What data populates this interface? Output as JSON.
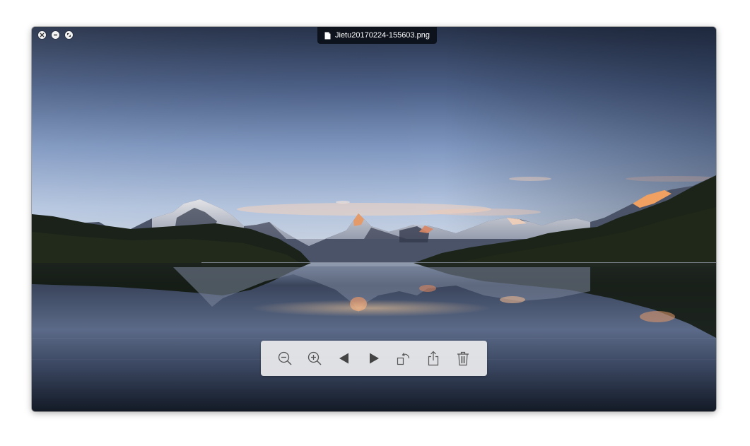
{
  "window": {
    "title": "Jietu20170224-155603.png",
    "controls": [
      "close-icon",
      "minimize-icon",
      "fullscreen-icon"
    ]
  },
  "toolbar": {
    "buttons": [
      {
        "name": "zoom-out",
        "icon": "zoom-out-icon"
      },
      {
        "name": "zoom-in",
        "icon": "zoom-in-icon"
      },
      {
        "name": "previous",
        "icon": "triangle-left-icon"
      },
      {
        "name": "next",
        "icon": "triangle-right-icon"
      },
      {
        "name": "rotate",
        "icon": "rotate-icon"
      },
      {
        "name": "share",
        "icon": "share-icon"
      },
      {
        "name": "delete",
        "icon": "trash-icon"
      }
    ]
  },
  "image": {
    "subject": "mountain-lake-sunset-photo"
  },
  "colors": {
    "sky_top": "#2a3448",
    "sky_mid": "#6d86b2",
    "sky_horizon": "#c7d4e8",
    "water": "#1b2434",
    "toolbar_bg": "#ececee",
    "title_bg": "#0a0e16"
  }
}
